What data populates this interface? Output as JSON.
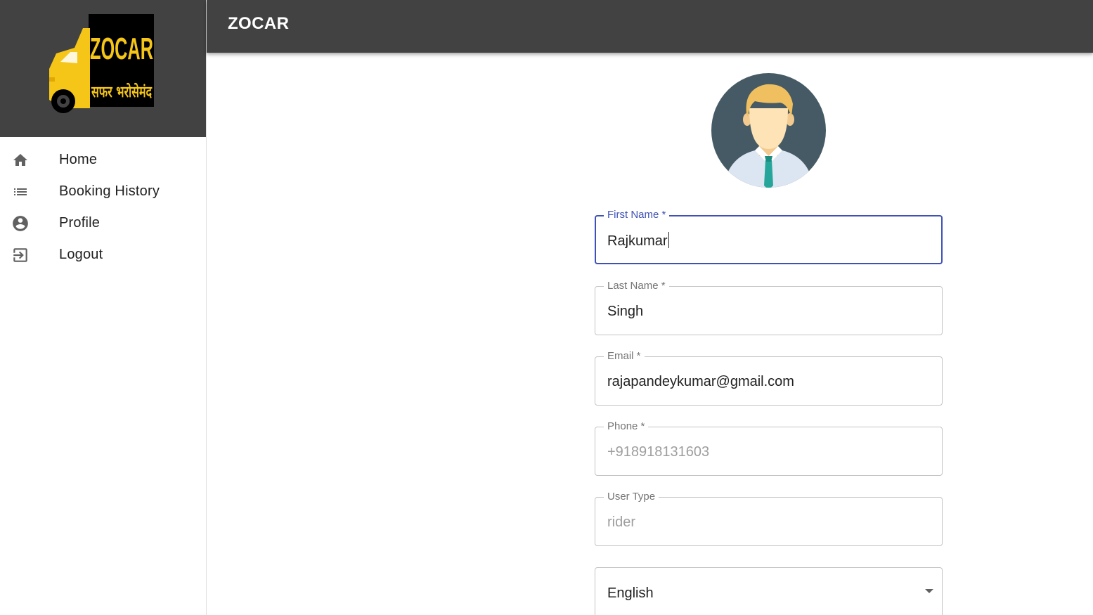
{
  "app": {
    "title": "ZOCAR"
  },
  "logo": {
    "text_top": "ZOCAR",
    "text_bottom": "सफर भरोसेमंद"
  },
  "sidebar": {
    "items": [
      {
        "label": "Home",
        "icon": "home-icon"
      },
      {
        "label": "Booking History",
        "icon": "list-icon"
      },
      {
        "label": "Profile",
        "icon": "account-circle-icon"
      },
      {
        "label": "Logout",
        "icon": "logout-icon"
      }
    ]
  },
  "profile": {
    "first_name": {
      "label": "First Name *",
      "value": "Rajkumar"
    },
    "last_name": {
      "label": "Last Name *",
      "value": "Singh"
    },
    "email": {
      "label": "Email *",
      "value": "rajapandeykumar@gmail.com"
    },
    "phone": {
      "label": "Phone *",
      "value": "+918918131603"
    },
    "user_type": {
      "label": "User Type",
      "value": "rider"
    },
    "language": {
      "value": "English"
    }
  },
  "colors": {
    "appbar": "#424242",
    "accent": "#3f51b5",
    "logo_yellow": "#f5c518",
    "avatar_bg": "#455a64"
  }
}
